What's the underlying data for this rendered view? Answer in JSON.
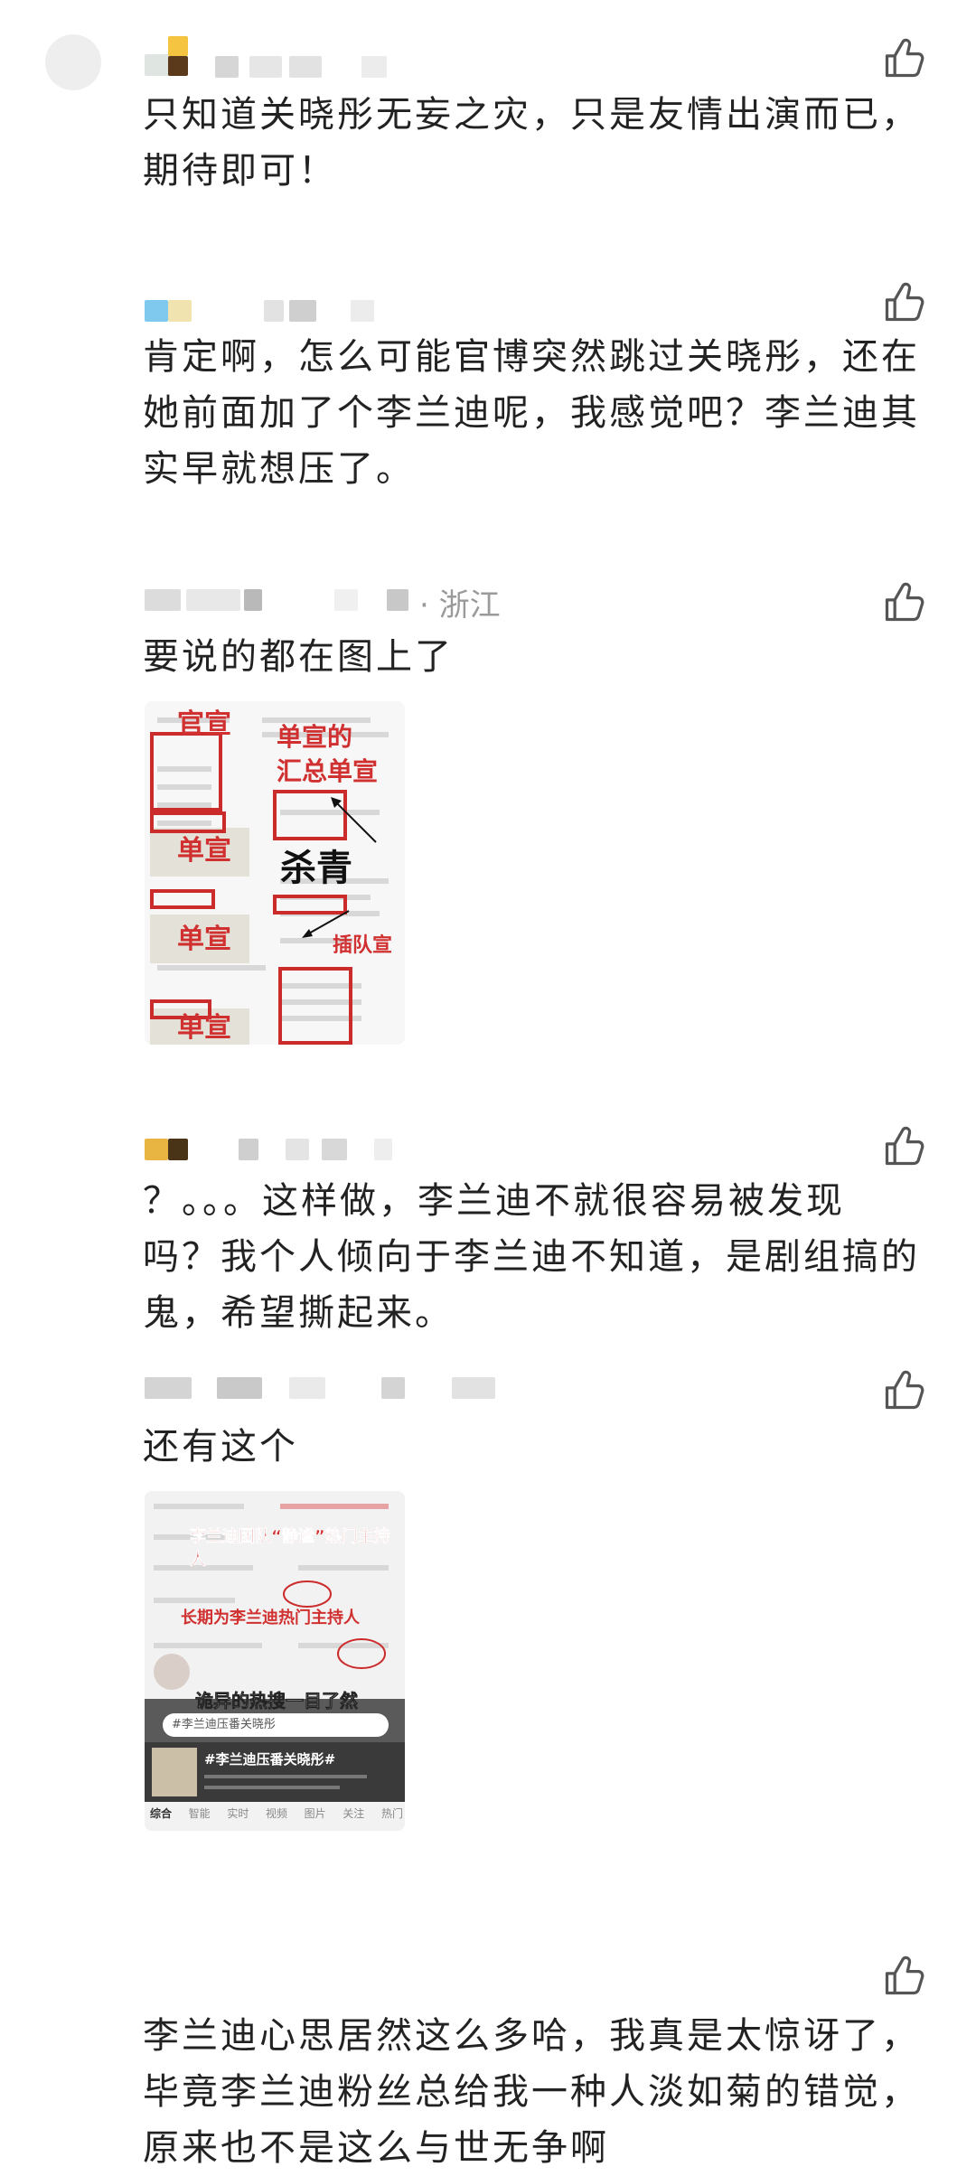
{
  "comments": [
    {
      "text": "只知道关晓彤无妄之灾，只是友情出演而已，期待即可！",
      "lines": [
        "只知道关晓彤无妄之灾，只是友情出演而已，",
        "期待即可！"
      ]
    },
    {
      "text": "肯定啊，怎么可能官博突然跳过关晓彤，还在她前面加了个李兰迪呢，我感觉吧？李兰迪其实早就想压了。",
      "lines": [
        "肯定啊，怎么可能官博突然跳过关晓彤，还在",
        "她前面加了个李兰迪呢，我感觉吧？李兰迪其",
        "实早就想压了。"
      ]
    },
    {
      "location": "· 浙江",
      "text": "要说的都在图上了",
      "image": {
        "labels": [
          "官宣",
          "单宣的",
          "汇总单宣",
          "单宣",
          "杀青",
          "单宣",
          "插队宣",
          "单宣"
        ]
      }
    },
    {
      "text": "？。。。这样做，李兰迪不就很容易被发现吗？我个人倾向于李兰迪不知道，是剧组搞的鬼，希望撕起来。",
      "lines": [
        "？。。。这样做，李兰迪不就很容易被发现",
        "吗？我个人倾向于李兰迪不知道，是剧组搞的",
        "鬼，希望撕起来。"
      ]
    },
    {
      "text": "还有这个",
      "image": {
        "labels": [
          "李兰迪团队“静谧”热门主持人",
          "长期为李兰迪热门主持人",
          "诡异的热搜一目了然"
        ],
        "search_text": "#李兰迪压番关晓彤",
        "hashtag": "#李兰迪压番关晓彤#",
        "tabs": [
          "综合",
          "智能",
          "实时",
          "视频",
          "图片",
          "关注",
          "热门"
        ]
      }
    },
    {
      "text": "李兰迪心思居然这么多哈，我真是太惊讶了，毕竟李兰迪粉丝总给我一种人淡如菊的错觉，原来也不是这么与世无争啊",
      "lines": [
        "李兰迪心思居然这么多哈，我真是太惊讶了，",
        "毕竟李兰迪粉丝总给我一种人淡如菊的错觉，",
        "原来也不是这么与世无争啊"
      ]
    }
  ],
  "icons": {
    "like": "thumbs-up-icon"
  },
  "colors": {
    "accent_red": "#cc2b2b",
    "text": "#222222",
    "meta": "#9a9a9a"
  }
}
